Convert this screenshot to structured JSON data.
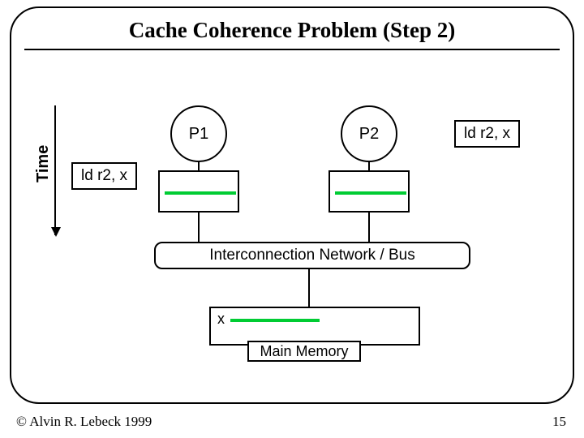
{
  "title": "Cache Coherence Problem (Step 2)",
  "processors": {
    "p1": "P1",
    "p2": "P2"
  },
  "time_axis_label": "Time",
  "ld_left": "ld r2, x",
  "ld_right": "ld r2, x",
  "bus_label": "Interconnection Network / Bus",
  "mem_var": "x",
  "mem_label": "Main Memory",
  "copyright": "© Alvin R. Lebeck 1999",
  "page_num": "15",
  "chart_data": {
    "type": "table",
    "title": "Cache Coherence Problem (Step 2)",
    "components": [
      "P1",
      "P2",
      "Cache of P1",
      "Cache of P2",
      "Interconnection Network / Bus",
      "Main Memory"
    ],
    "events_over_time": [
      {
        "at": "P1",
        "op": "ld r2, x",
        "result": "x loaded into P1 cache"
      },
      {
        "at": "P2",
        "op": "ld r2, x",
        "result": "x loaded into P2 cache"
      }
    ],
    "memory_contents": {
      "variable": "x"
    },
    "caches_after_step": {
      "P1": [
        "x"
      ],
      "P2": [
        "x"
      ]
    }
  }
}
